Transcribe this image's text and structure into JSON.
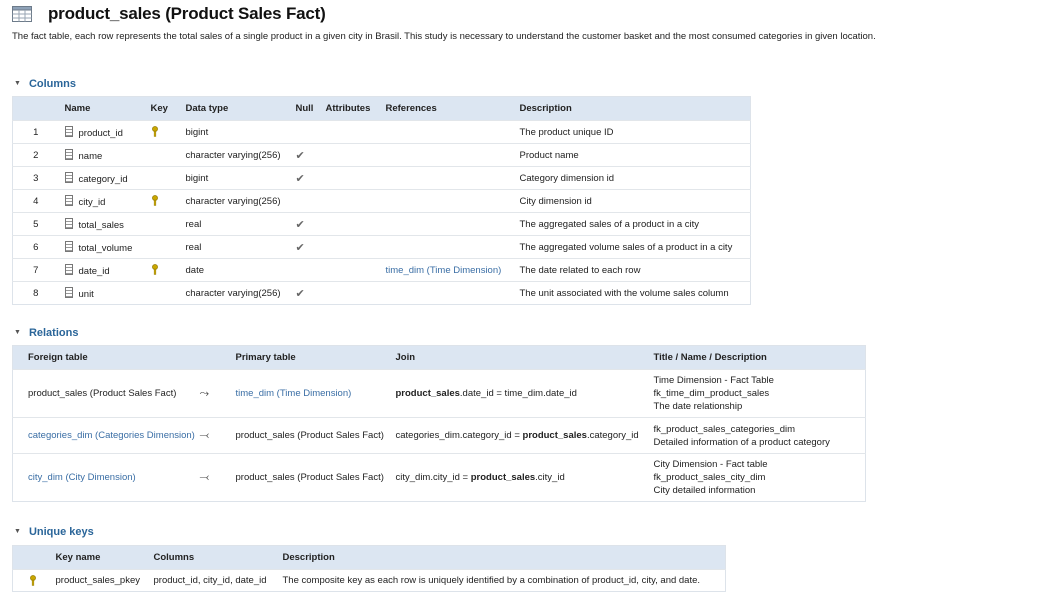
{
  "page": {
    "title": "product_sales (Product Sales Fact)",
    "description": "The fact table, each row represents the total sales of a single product in a given city in Brasil. This study is necessary to understand the customer basket and the most consumed categories in given location."
  },
  "columns": {
    "section_title": "Columns",
    "headers": [
      "Name",
      "Key",
      "Data type",
      "Null",
      "Attributes",
      "References",
      "Description"
    ],
    "rows": [
      {
        "num": "1",
        "name": "product_id",
        "key": true,
        "type": "bigint",
        "null": false,
        "attributes": "",
        "references": "",
        "description": "The product unique ID"
      },
      {
        "num": "2",
        "name": "name",
        "key": false,
        "type": "character varying(256)",
        "null": true,
        "attributes": "",
        "references": "",
        "description": "Product name"
      },
      {
        "num": "3",
        "name": "category_id",
        "key": false,
        "type": "bigint",
        "null": true,
        "attributes": "",
        "references": "",
        "description": "Category dimension id"
      },
      {
        "num": "4",
        "name": "city_id",
        "key": true,
        "type": "character varying(256)",
        "null": false,
        "attributes": "",
        "references": "",
        "description": "City dimension id"
      },
      {
        "num": "5",
        "name": "total_sales",
        "key": false,
        "type": "real",
        "null": true,
        "attributes": "",
        "references": "",
        "description": "The aggregated sales of a product in a city"
      },
      {
        "num": "6",
        "name": "total_volume",
        "key": false,
        "type": "real",
        "null": true,
        "attributes": "",
        "references": "",
        "description": "The aggregated volume sales of a product in a city"
      },
      {
        "num": "7",
        "name": "date_id",
        "key": true,
        "type": "date",
        "null": false,
        "attributes": "",
        "references": "time_dim (Time Dimension)",
        "description": "The date related to each row"
      },
      {
        "num": "8",
        "name": "unit",
        "key": false,
        "type": "character varying(256)",
        "null": true,
        "attributes": "",
        "references": "",
        "description": "The unit associated with the volume sales column"
      }
    ]
  },
  "relations": {
    "section_title": "Relations",
    "headers": [
      "Foreign table",
      "Primary table",
      "Join",
      "Title / Name / Description"
    ],
    "rows": [
      {
        "foreign": "product_sales (Product Sales Fact)",
        "foreign_link": false,
        "primary": "time_dim (Time Dimension)",
        "primary_link": true,
        "join_pre": "",
        "join_bold1": "product_sales",
        "join_mid": ".date_id = time_dim.date_id",
        "join_bold2": "",
        "join_post": "",
        "info": [
          "Time Dimension - Fact Table",
          "fk_time_dim_product_sales",
          "The date relationship"
        ]
      },
      {
        "foreign": "categories_dim (Categories Dimension)",
        "foreign_link": true,
        "primary": "product_sales (Product Sales Fact)",
        "primary_link": false,
        "join_pre": "categories_dim.category_id = ",
        "join_bold1": "product_sales",
        "join_mid": ".category_id",
        "join_bold2": "",
        "join_post": "",
        "info": [
          "fk_product_sales_categories_dim",
          "Detailed information of a product category"
        ]
      },
      {
        "foreign": "city_dim (City Dimension)",
        "foreign_link": true,
        "primary": "product_sales (Product Sales Fact)",
        "primary_link": false,
        "join_pre": "city_dim.city_id = ",
        "join_bold1": "product_sales",
        "join_mid": ".city_id",
        "join_bold2": "",
        "join_post": "",
        "info": [
          "City Dimension - Fact table",
          "fk_product_sales_city_dim",
          "City detailed information"
        ]
      }
    ]
  },
  "unique_keys": {
    "section_title": "Unique keys",
    "headers": [
      "Key name",
      "Columns",
      "Description"
    ],
    "rows": [
      {
        "name": "product_sales_pkey",
        "columns": "product_id, city_id, date_id",
        "description": "The composite key as each row is uniquely identified by a combination of product_id, city, and date."
      }
    ]
  },
  "icons": {
    "table": "table-icon",
    "column": "column-icon",
    "key": "key-icon",
    "check": "check-icon",
    "relation_outgoing": "relation-outgoing-icon",
    "relation_incoming": "relation-incoming-icon",
    "collapse": "chevron-down-icon"
  },
  "colors": {
    "link": "#3a6ea5",
    "section_title": "#2a6599",
    "header_bg": "#dce6f2",
    "key": "#c9a600"
  }
}
